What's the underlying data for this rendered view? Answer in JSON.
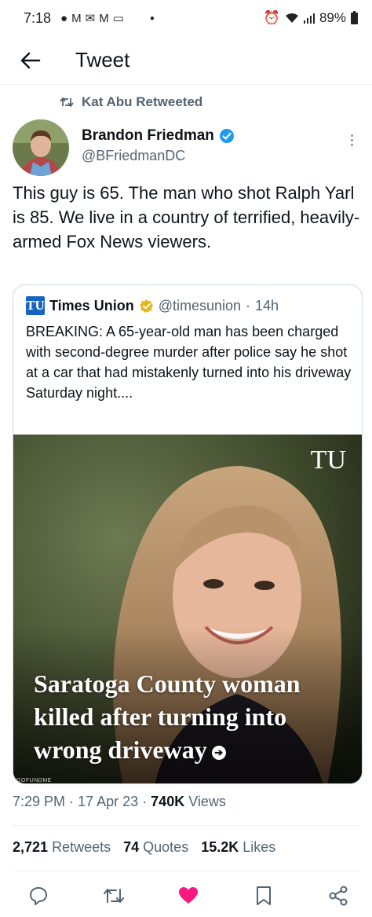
{
  "status_bar": {
    "time": "7:18",
    "notification_icons": [
      "chat-bubble-icon",
      "gmail-icon",
      "mail-icon",
      "gmail-icon",
      "screen-icon"
    ],
    "battery": "89%"
  },
  "header": {
    "title": "Tweet"
  },
  "retweet_notice": "Kat Abu Retweeted",
  "author": {
    "name": "Brandon Friedman",
    "handle": "@BFriedmanDC",
    "verified": true
  },
  "tweet_text": "This guy is 65. The man who shot Ralph Yarl is 85. We live in a country of terrified, heavily-armed Fox News viewers.",
  "quote": {
    "logo": "TU",
    "name": "Times Union",
    "handle": "@timesunion",
    "separator": "·",
    "time": "14h",
    "text": "BREAKING: A 65-year-old man has been charged with second-degree murder after police say he shot at a car that had mistakenly turned into his driveway Saturday night....",
    "media": {
      "watermark": "TU",
      "headline": "Saratoga County woman killed after turning into wrong driveway",
      "arrow": "➔",
      "credit": "GOFUNDME"
    }
  },
  "meta": {
    "time": "7:29 PM",
    "sep1": "·",
    "date": "17 Apr 23",
    "sep2": "·",
    "views_count": "740K",
    "views_label": "Views"
  },
  "stats": {
    "retweets_count": "2,721",
    "retweets_label": "Retweets",
    "quotes_count": "74",
    "quotes_label": "Quotes",
    "likes_count": "15.2K",
    "likes_label": "Likes"
  },
  "colors": {
    "verified_blue": "#1d9bf0",
    "verified_gold": "#e2b719",
    "like_pink": "#f91880",
    "secondary_text": "#536471"
  }
}
